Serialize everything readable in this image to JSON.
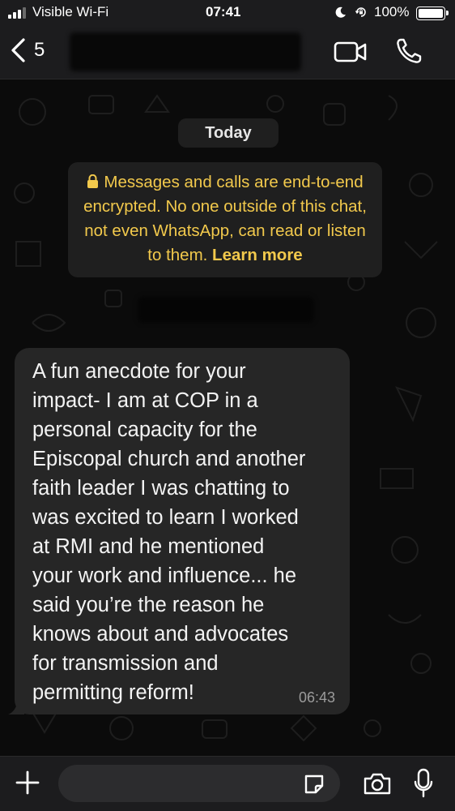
{
  "status_bar": {
    "carrier": "Visible Wi-Fi",
    "time": "07:41",
    "battery": "100%",
    "battery_level": 1.0,
    "icons": [
      "signal-icon",
      "moon-icon",
      "rotation-lock-icon",
      "battery-icon"
    ]
  },
  "header": {
    "back_count": "5",
    "icons": [
      "chevron-left-icon",
      "video-call-icon",
      "phone-icon"
    ]
  },
  "chat": {
    "date_label": "Today",
    "encryption_notice": "Messages and calls are end-to-end encrypted. No one outside of this chat, not even WhatsApp, can read or listen to them.",
    "learn_more": "Learn more",
    "message": {
      "text": "A fun anecdote for your\nimpact- I am at COP in a\npersonal capacity for the\nEpiscopal church and another\nfaith leader I was chatting to\nwas excited to learn I worked\nat RMI and he mentioned\nyour work and influence... he\nsaid you’re the reason he\nknows about and advocates\nfor transmission and\npermitting reform!",
      "time": "06:43"
    }
  },
  "input_bar": {
    "placeholder": "",
    "icons": [
      "plus-icon",
      "sticker-icon",
      "camera-icon",
      "microphone-icon"
    ]
  },
  "colors": {
    "background": "#0b0b0b",
    "bars": "#1c1c1e",
    "bubble": "#262626",
    "notice_text": "#f2c94c"
  }
}
